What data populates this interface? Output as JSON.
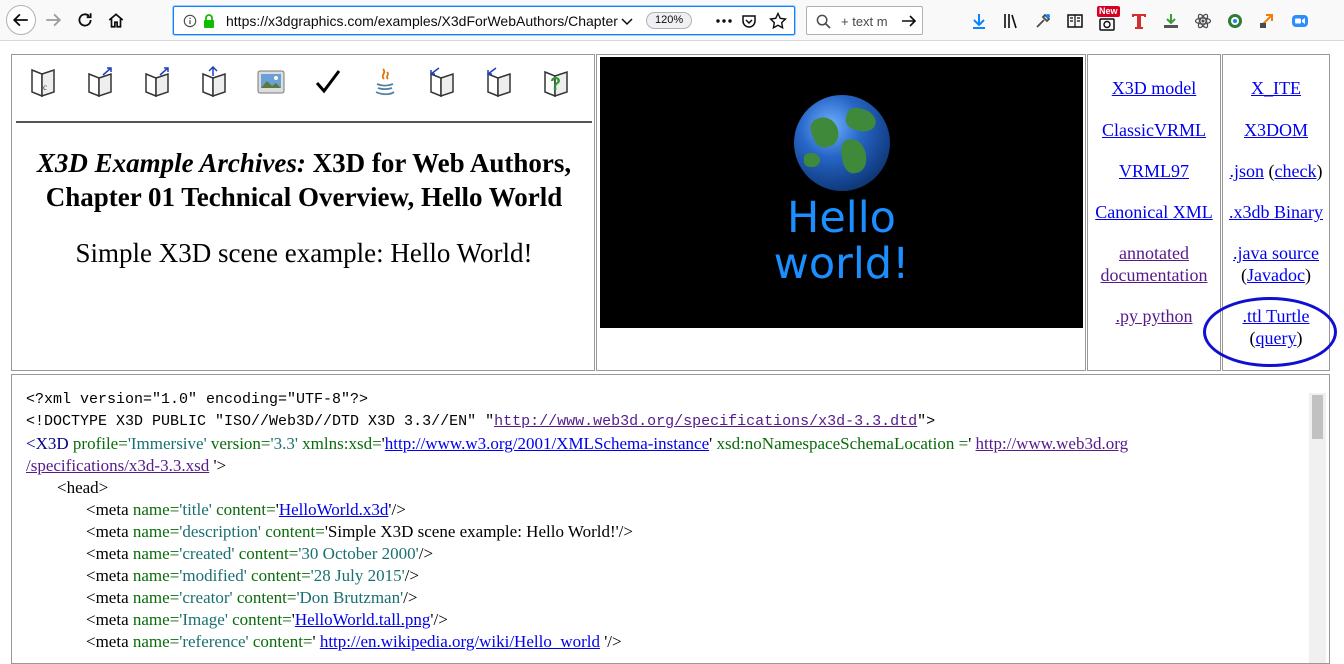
{
  "browser": {
    "url": "https://x3dgraphics.com/examples/X3dForWebAuthors/Chapter",
    "zoom": "120%",
    "search_placeholder": "+ text m",
    "new_badge": "New"
  },
  "header": {
    "title_italic": "X3D Example Archives:",
    "title_rest": " X3D for Web Authors, Chapter 01 Technical Overview, Hello World",
    "subtitle": "Simple X3D scene example: Hello World!"
  },
  "render": {
    "line1": "Hello",
    "line2": "world!"
  },
  "links_col1": {
    "x3d_model": "X3D model",
    "classic_vrml": "ClassicVRML",
    "vrml97": "VRML97",
    "canonical_xml": "Canonical XML",
    "annotated": "annotated",
    "documentation": "documentation",
    "py_python": ".py python"
  },
  "links_col2": {
    "x_ite": "X_ITE",
    "x3dom": "X3DOM",
    "json": ".json",
    "check": "check",
    "x3db": ".x3db Binary",
    "java_source": ".java source",
    "javadoc": "Javadoc",
    "ttl_turtle": ".ttl Turtle",
    "query": "query"
  },
  "code": {
    "xml_decl": "<?xml version=\"1.0\" encoding=\"UTF-8\"?>",
    "doctype_pre": "<!DOCTYPE X3D PUBLIC \"ISO//Web3D//DTD X3D 3.3//EN\" \"",
    "doctype_link": "http://www.web3d.org/specifications/x3d-3.3.dtd",
    "doctype_post": "\">",
    "x3d_open": "<X3D",
    "profile_attr": " profile=",
    "profile_val": "'Immersive'",
    "version_attr": " version=",
    "version_val": "'3.3'",
    "xmlns_attr": "  xmlns:xsd=",
    "xmlns_q1": "'",
    "xmlns_link": "http://www.w3.org/2001/XMLSchema-instance",
    "xmlns_q2": "'",
    "nsloc_attr": " xsd:noNamespaceSchemaLocation =",
    "nsloc_q1": "' ",
    "nsloc_link1": "http://www.web3d.org",
    "nsloc_link2": "/specifications/x3d-3.3.xsd",
    "nsloc_q2": " '>",
    "head_open": "<head>",
    "meta_rows": [
      {
        "name": "'title'",
        "pre": "'",
        "link": "HelloWorld.x3d",
        "text": "",
        "post": "'/>"
      },
      {
        "name": "'description'",
        "pre": "'Simple X3D scene example: Hello World!'/>",
        "link": "",
        "text": "",
        "post": ""
      },
      {
        "name": "'created'",
        "pre": "",
        "link": "",
        "text": "'30 October 2000'",
        "post": "/>"
      },
      {
        "name": "'modified'",
        "pre": "",
        "link": "",
        "text": "'28 July 2015'",
        "post": "/>"
      },
      {
        "name": "'creator'",
        "pre": "",
        "link": "",
        "text": "'Don Brutzman'",
        "post": "/>"
      },
      {
        "name": "'Image'",
        "pre": "'",
        "link": "HelloWorld.tall.png",
        "text": "",
        "post": "'/>"
      },
      {
        "name": "'reference'",
        "pre": "' ",
        "link": "http://en.wikipedia.org/wiki/Hello_world",
        "text": "",
        "post": " '/>"
      }
    ],
    "meta_open": "<meta",
    "name_attr": " name=",
    "content_attr": " content="
  }
}
